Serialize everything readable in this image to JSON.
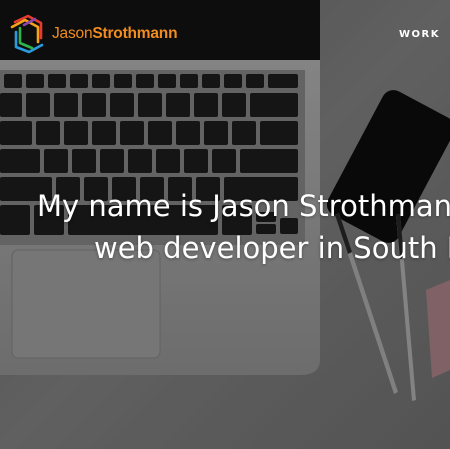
{
  "brand": {
    "name_first": "Jason",
    "name_last": "Strothmann",
    "accent_color": "#f28c1e",
    "logo_icon": "hexagon-logo-icon"
  },
  "nav": {
    "items": [
      {
        "label": "WORK"
      }
    ]
  },
  "hero": {
    "headline_line1": "My name is Jason Strothmann",
    "headline_line2": "web developer in South F",
    "background": "laptop-phone-pens-desk-photo"
  }
}
